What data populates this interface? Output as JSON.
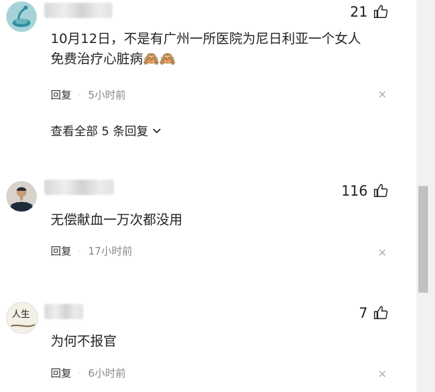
{
  "comments": [
    {
      "likes": "21",
      "text_lines": [
        "10月12日，不是有广州一所医院为尼日利亚一个女人",
        "免费治疗心脏病"
      ],
      "emoji": "🙈🙈",
      "reply_label": "回复",
      "dot": "·",
      "time": "5小时前",
      "view_all": "查看全部 5 条回复"
    },
    {
      "likes": "116",
      "text_lines": [
        "无偿献血一万次都没用"
      ],
      "reply_label": "回复",
      "dot": "·",
      "time": "17小时前"
    },
    {
      "likes": "7",
      "text_lines": [
        "为何不报官"
      ],
      "reply_label": "回复",
      "dot": "·",
      "time": "6小时前",
      "avatar_text": "人生"
    }
  ],
  "icons": {
    "like": "thumbs-up-icon",
    "close": "close-icon",
    "expand": "chevron-down-icon"
  },
  "colors": {
    "text": "#222222",
    "meta_time": "#888888",
    "scrollbar_thumb": "#c1c1c1"
  }
}
